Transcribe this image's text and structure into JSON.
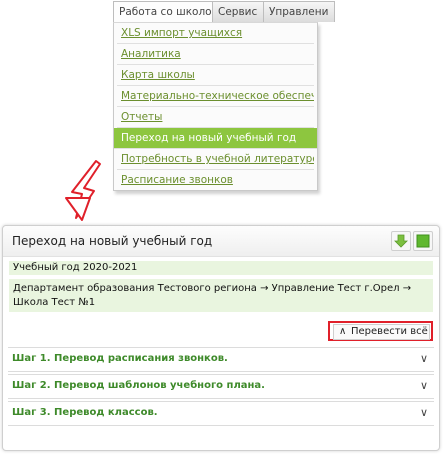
{
  "menu": {
    "tabs": [
      {
        "label": "Работа со школой"
      },
      {
        "label": "Сервис"
      },
      {
        "label": "Управлени"
      }
    ],
    "items": [
      {
        "label": "XLS импорт учащихся"
      },
      {
        "label": "Аналитика"
      },
      {
        "label": "Карта школы"
      },
      {
        "label": "Материально-техническое обеспечение"
      },
      {
        "label": "Отчеты"
      },
      {
        "label": "Переход на новый учебный год"
      },
      {
        "label": "Потребность в учебной литературе"
      },
      {
        "label": "Расписание звонков"
      }
    ],
    "active_index": 5
  },
  "panel": {
    "title": "Переход на новый учебный год",
    "year": "Учебный год 2020-2021",
    "department": "Департамент образования Тестового региона → Управление Тест г.Орел → Школа Тест №1",
    "translate_all": "Перевести всё",
    "steps": [
      {
        "label": "Шаг 1. Перевод расписания звонков."
      },
      {
        "label": "Шаг 2. Перевод шаблонов учебного плана."
      },
      {
        "label": "Шаг 3. Перевод классов."
      }
    ]
  },
  "colors": {
    "accent_green": "#8dc63f",
    "link_green": "#6b8f2e",
    "highlight_red": "#e0202a",
    "band_green": "#e9f5df"
  }
}
